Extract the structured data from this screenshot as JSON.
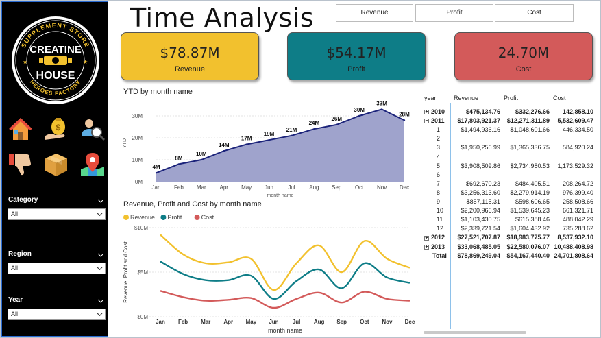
{
  "page": {
    "title": "Time Analysis"
  },
  "brand": {
    "top_text": "SUPPLEMENT STORE",
    "name_line1": "CREATINE",
    "name_line2": "HOUSE",
    "bottom_text": "HEROES FACTORY"
  },
  "nav_icons": [
    {
      "name": "home-icon"
    },
    {
      "name": "money-bag-icon"
    },
    {
      "name": "customer-search-icon"
    },
    {
      "name": "thumbs-down-icon"
    },
    {
      "name": "product-box-icon"
    },
    {
      "name": "map-pin-icon"
    }
  ],
  "slicers": [
    {
      "label": "Category",
      "value": "All"
    },
    {
      "label": "Region",
      "value": "All"
    },
    {
      "label": "Year",
      "value": "All"
    }
  ],
  "top_buttons": [
    {
      "label": "Revenue"
    },
    {
      "label": "Profit"
    },
    {
      "label": "Cost"
    }
  ],
  "kpis": [
    {
      "value": "$78.87M",
      "label": "Revenue",
      "color": "#f2c12e"
    },
    {
      "value": "$54.17M",
      "label": "Profit",
      "color": "#0e7d87"
    },
    {
      "value": "24.70M",
      "label": "Cost",
      "color": "#d35a5a"
    }
  ],
  "chart_data": [
    {
      "type": "area",
      "title": "YTD by month name",
      "xlabel": "month name",
      "ylabel": "YTD",
      "categories": [
        "Jan",
        "Feb",
        "Mar",
        "Apr",
        "May",
        "Jun",
        "Jul",
        "Aug",
        "Sep",
        "Oct",
        "Nov",
        "Dec"
      ],
      "values": [
        4,
        8,
        10,
        14,
        17,
        19,
        21,
        24,
        26,
        30,
        33,
        28
      ],
      "data_labels": [
        "4M",
        "8M",
        "10M",
        "14M",
        "17M",
        "19M",
        "21M",
        "24M",
        "26M",
        "30M",
        "33M",
        "28M"
      ],
      "y_ticks": [
        "0M",
        "10M",
        "20M",
        "30M"
      ],
      "ylim": [
        0,
        35
      ],
      "colors": {
        "line": "#1b237a",
        "fill": "#9fa3cc"
      }
    },
    {
      "type": "line",
      "title": "Revenue, Profit and Cost by month name",
      "xlabel": "month name",
      "ylabel": "Revenue, Profit and Cost",
      "categories": [
        "Jan",
        "Feb",
        "Mar",
        "Apr",
        "May",
        "Jun",
        "Jul",
        "Aug",
        "Sep",
        "Oct",
        "Nov",
        "Dec"
      ],
      "y_ticks": [
        "$0M",
        "$5M",
        "$10M"
      ],
      "ylim": [
        0,
        10
      ],
      "legend": "top-left",
      "series": [
        {
          "name": "Revenue",
          "color": "#f2c12e",
          "values": [
            9.2,
            7.0,
            6.0,
            6.1,
            6.5,
            3.0,
            6.0,
            8.0,
            5.0,
            8.5,
            6.5,
            5.5
          ]
        },
        {
          "name": "Profit",
          "color": "#0e7d87",
          "values": [
            6.2,
            4.8,
            4.1,
            4.1,
            4.6,
            2.0,
            4.0,
            5.3,
            3.2,
            6.0,
            4.4,
            3.8
          ]
        },
        {
          "name": "Cost",
          "color": "#d35a5a",
          "values": [
            2.9,
            2.2,
            1.8,
            1.9,
            2.1,
            1.0,
            2.0,
            2.7,
            1.6,
            2.8,
            2.0,
            1.8
          ]
        }
      ]
    }
  ],
  "table": {
    "headers": [
      "year",
      "Revenue",
      "Profit",
      "Cost"
    ],
    "rows": [
      {
        "year": "2010",
        "expander": "⊞",
        "bold": true,
        "revenue": "$475,134.76",
        "profit": "$332,276.66",
        "cost": "142,858.10"
      },
      {
        "year": "2011",
        "expander": "⊟",
        "bold": true,
        "revenue": "$17,803,921.37",
        "profit": "$12,271,311.89",
        "cost": "5,532,609.47"
      },
      {
        "year": "1",
        "revenue": "$1,494,936.16",
        "profit": "$1,048,601.66",
        "cost": "446,334.50"
      },
      {
        "year": "2",
        "revenue": "",
        "profit": "",
        "cost": ""
      },
      {
        "year": "3",
        "revenue": "$1,950,256.99",
        "profit": "$1,365,336.75",
        "cost": "584,920.24"
      },
      {
        "year": "4",
        "revenue": "",
        "profit": "",
        "cost": ""
      },
      {
        "year": "5",
        "revenue": "$3,908,509.86",
        "profit": "$2,734,980.53",
        "cost": "1,173,529.32"
      },
      {
        "year": "6",
        "revenue": "",
        "profit": "",
        "cost": ""
      },
      {
        "year": "7",
        "revenue": "$692,670.23",
        "profit": "$484,405.51",
        "cost": "208,264.72"
      },
      {
        "year": "8",
        "revenue": "$3,256,313.60",
        "profit": "$2,279,914.19",
        "cost": "976,399.40"
      },
      {
        "year": "9",
        "revenue": "$857,115.31",
        "profit": "$598,606.65",
        "cost": "258,508.66"
      },
      {
        "year": "10",
        "revenue": "$2,200,966.94",
        "profit": "$1,539,645.23",
        "cost": "661,321.71"
      },
      {
        "year": "11",
        "revenue": "$1,103,430.75",
        "profit": "$615,388.46",
        "cost": "488,042.29"
      },
      {
        "year": "12",
        "revenue": "$2,339,721.54",
        "profit": "$1,604,432.92",
        "cost": "735,288.62"
      },
      {
        "year": "2012",
        "expander": "⊞",
        "bold": true,
        "revenue": "$27,521,707.87",
        "profit": "$18,983,775.77",
        "cost": "8,537,932.10"
      },
      {
        "year": "2013",
        "expander": "⊞",
        "bold": true,
        "revenue": "$33,068,485.05",
        "profit": "$22,580,076.07",
        "cost": "10,488,408.98"
      },
      {
        "year": "Total",
        "bold": true,
        "revenue": "$78,869,249.04",
        "profit": "$54,167,440.40",
        "cost": "24,701,808.64"
      }
    ]
  }
}
